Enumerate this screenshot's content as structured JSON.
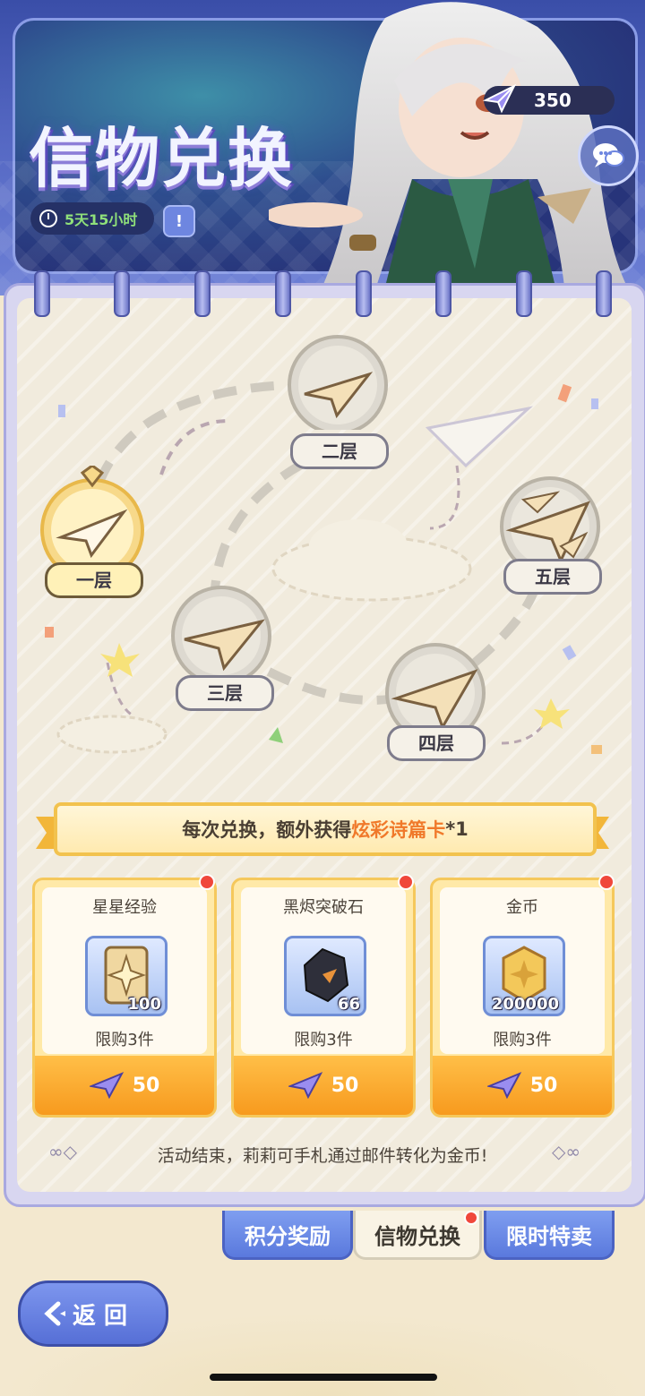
{
  "header": {
    "title": "信物兑换",
    "timer": "5天15小时",
    "currency_value": "350"
  },
  "map": {
    "floors": [
      {
        "label": "一层",
        "state": "active"
      },
      {
        "label": "二层",
        "state": "locked"
      },
      {
        "label": "三层",
        "state": "locked"
      },
      {
        "label": "四层",
        "state": "locked"
      },
      {
        "label": "五层",
        "state": "locked"
      }
    ]
  },
  "banner": {
    "prefix": "每次兑换，额外获得",
    "highlight": "炫彩诗篇卡",
    "suffix": "*1"
  },
  "cards": [
    {
      "name": "星星经验",
      "quantity": "100",
      "limit": "限购3件",
      "price": "50",
      "icon": "star-card-icon"
    },
    {
      "name": "黑烬突破石",
      "quantity": "66",
      "limit": "限购3件",
      "price": "50",
      "icon": "black-stone-icon"
    },
    {
      "name": "金币",
      "quantity": "200000",
      "limit": "限购3件",
      "price": "50",
      "icon": "gold-coin-icon"
    }
  ],
  "footer_note": "活动结束，莉莉可手札通过邮件转化为金币!",
  "tabs": [
    {
      "label": "积分奖励",
      "active": false
    },
    {
      "label": "信物兑换",
      "active": true
    },
    {
      "label": "限时特卖",
      "active": false
    }
  ],
  "back_button": "返 回",
  "colors": {
    "accent_orange": "#f79a1e",
    "highlight": "#f0792a",
    "header_blue": "#3a4ea8",
    "tab_blue": "#5a79dd"
  }
}
